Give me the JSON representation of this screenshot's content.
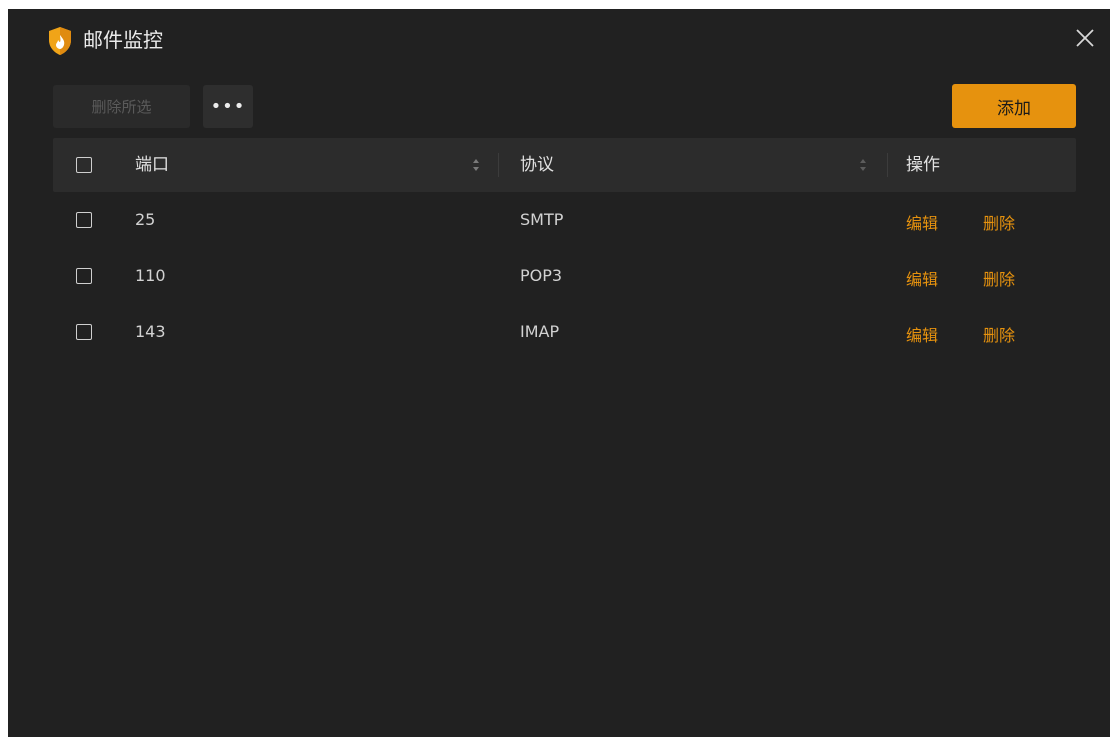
{
  "window": {
    "title": "邮件监控",
    "close_icon": "close-icon",
    "app_icon": "shield-flame-icon",
    "accent_color": "#e6920e"
  },
  "toolbar": {
    "delete_selected_label": "删除所选",
    "more_label": "•••",
    "add_label": "添加"
  },
  "table": {
    "columns": {
      "port": "端口",
      "protocol": "协议",
      "actions": "操作"
    },
    "rows": [
      {
        "port": "25",
        "protocol": "SMTP",
        "edit": "编辑",
        "delete": "删除"
      },
      {
        "port": "110",
        "protocol": "POP3",
        "edit": "编辑",
        "delete": "删除"
      },
      {
        "port": "143",
        "protocol": "IMAP",
        "edit": "编辑",
        "delete": "删除"
      }
    ]
  }
}
